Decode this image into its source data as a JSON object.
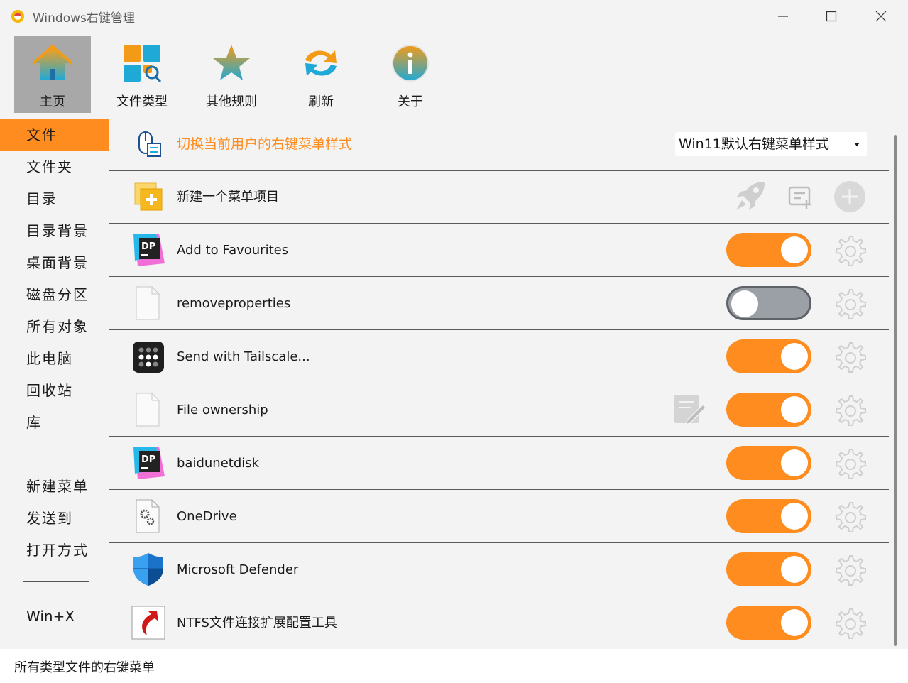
{
  "window": {
    "title": "Windows右键管理",
    "controls": [
      "minimize-icon",
      "maximize-icon",
      "close-icon"
    ]
  },
  "toolbar": {
    "items": [
      {
        "label": "主页",
        "icon": "home-icon",
        "active": true
      },
      {
        "label": "文件类型",
        "icon": "file-types-icon",
        "active": false
      },
      {
        "label": "其他规则",
        "icon": "star-icon",
        "active": false
      },
      {
        "label": "刷新",
        "icon": "refresh-icon",
        "active": false
      },
      {
        "label": "关于",
        "icon": "info-icon",
        "active": false
      }
    ]
  },
  "sidebar": {
    "items": [
      {
        "label": "文件",
        "active": true
      },
      {
        "label": "文件夹"
      },
      {
        "label": "目录"
      },
      {
        "label": "目录背景"
      },
      {
        "label": "桌面背景"
      },
      {
        "label": "磁盘分区"
      },
      {
        "label": "所有对象"
      },
      {
        "label": "此电脑"
      },
      {
        "label": "回收站"
      },
      {
        "label": "库"
      },
      {
        "label": "新建菜单"
      },
      {
        "label": "发送到"
      },
      {
        "label": "打开方式"
      },
      {
        "label": "Win+X"
      }
    ]
  },
  "main": {
    "style_row": {
      "label": "切换当前用户的右键菜单样式",
      "icon": "mouse-menu-icon",
      "dropdown_value": "Win11默认右键菜单样式"
    },
    "new_row": {
      "label": "新建一个菜单项目",
      "icon": "new-item-icon",
      "actions": [
        "rocket-icon",
        "add-list-icon",
        "plus-circle-icon"
      ]
    },
    "items": [
      {
        "label": "Add to Favourites",
        "icon": "dp-app-icon",
        "enabled": true
      },
      {
        "label": "removeproperties",
        "icon": "blank-file-icon",
        "enabled": false
      },
      {
        "label": "Send with Tailscale...",
        "icon": "tailscale-icon",
        "enabled": true
      },
      {
        "label": "File ownership",
        "icon": "blank-file-icon",
        "enabled": true,
        "extra": "edit-icon"
      },
      {
        "label": "baidunetdisk",
        "icon": "dp-app-icon",
        "enabled": true
      },
      {
        "label": "OneDrive",
        "icon": "settings-file-icon",
        "enabled": true
      },
      {
        "label": "Microsoft Defender",
        "icon": "defender-shield-icon",
        "enabled": true
      },
      {
        "label": "NTFS文件连接扩展配置工具",
        "icon": "ntfs-arrow-icon",
        "enabled": true
      }
    ]
  },
  "status": {
    "text": "所有类型文件的右键菜单"
  },
  "colors": {
    "accent": "#ff8c1e",
    "background": "#f3f3f3",
    "selected_tool": "#a8a8a8"
  }
}
